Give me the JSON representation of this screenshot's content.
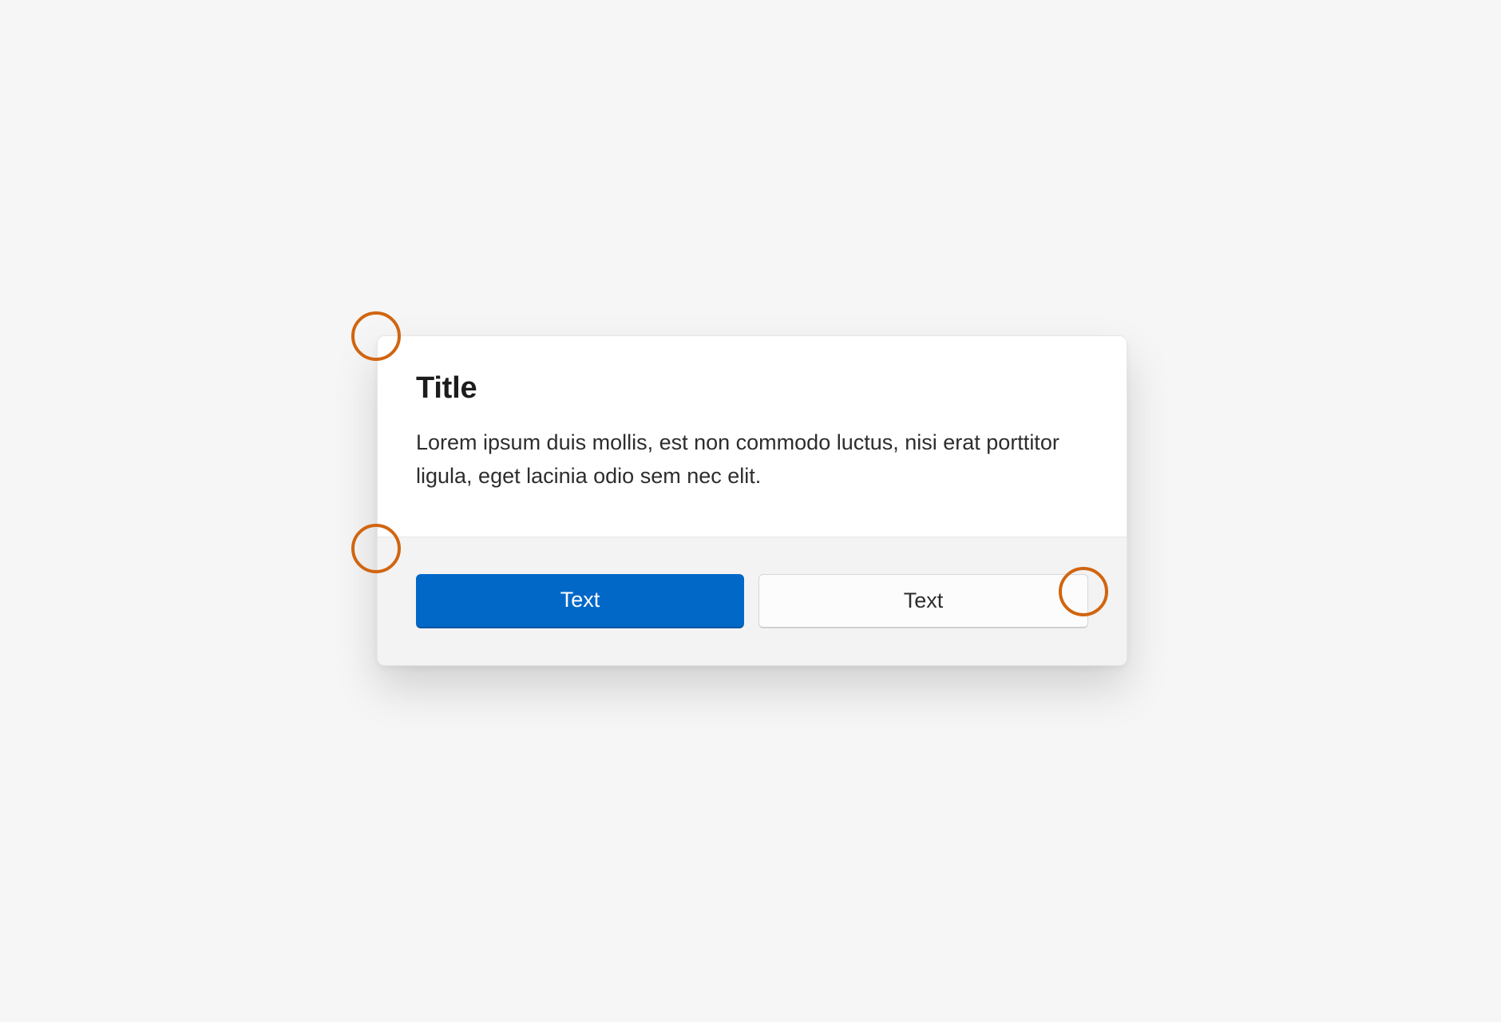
{
  "dialog": {
    "title": "Title",
    "body": "Lorem ipsum duis mollis, est non commodo luctus, nisi erat porttitor ligula, eget lacinia odio sem nec elit.",
    "primary_button": "Text",
    "secondary_button": "Text"
  },
  "colors": {
    "accent": "#0268c8",
    "annotation": "#d16510"
  }
}
